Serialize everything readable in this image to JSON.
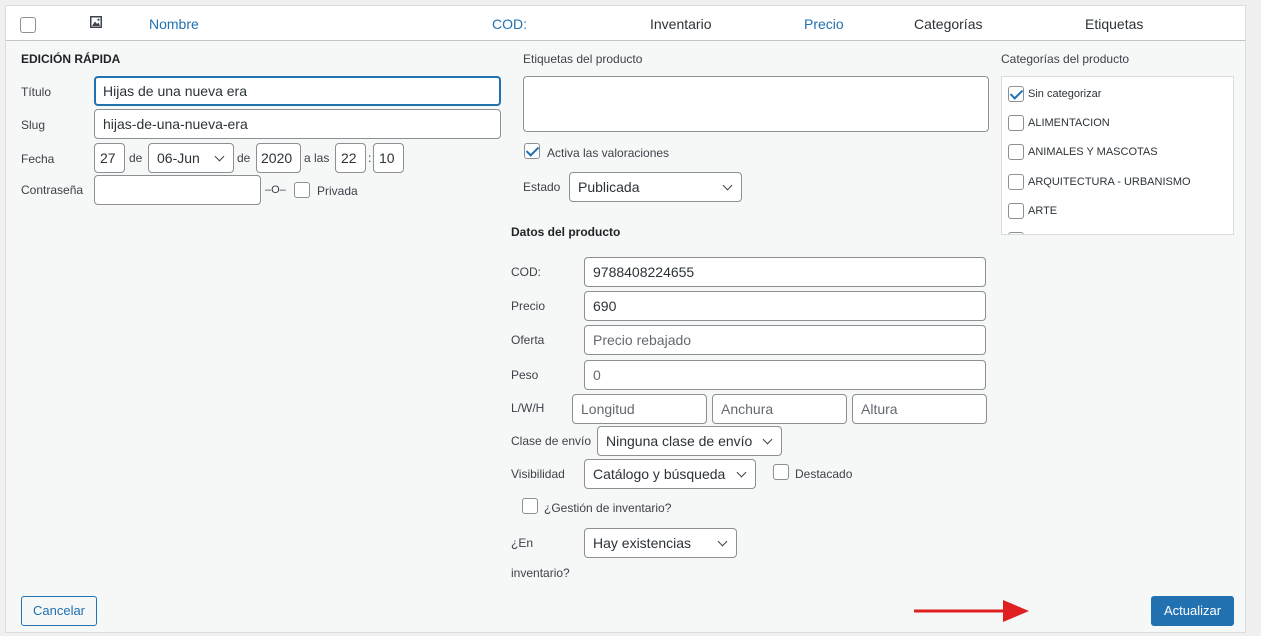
{
  "table_header": {
    "columns": [
      "Nombre",
      "COD:",
      "Inventario",
      "Precio",
      "Categorías",
      "Etiquetas"
    ]
  },
  "quick_edit": {
    "title": "EDICIÓN RÁPIDA",
    "titulo_label": "Título",
    "titulo_value": "Hijas de una nueva era",
    "slug_label": "Slug",
    "slug_value": "hijas-de-una-nueva-era",
    "fecha_label": "Fecha",
    "day": "27",
    "de1": "de",
    "month": "06-Jun",
    "de2": "de",
    "year": "2020",
    "a_las": "a las",
    "hour": "22",
    "colon": ":",
    "minute": "10",
    "password_label": "Contraseña",
    "password_value": "",
    "or_label": "–O–",
    "private_label": "Privada",
    "private_checked": false
  },
  "tags": {
    "label": "Etiquetas del producto",
    "value": "",
    "reviews_label": "Activa las valoraciones",
    "reviews_checked": true,
    "estado_label": "Estado",
    "estado_value": "Publicada"
  },
  "product_data": {
    "heading": "Datos del producto",
    "cod_label": "COD:",
    "cod_value": "9788408224655",
    "precio_label": "Precio",
    "precio_value": "690",
    "oferta_label": "Oferta",
    "oferta_placeholder": "Precio rebajado",
    "peso_label": "Peso",
    "peso_placeholder": "0",
    "lwh_label": "L/W/H",
    "longitud_placeholder": "Longitud",
    "anchura_placeholder": "Anchura",
    "altura_placeholder": "Altura",
    "envio_label": "Clase de envío",
    "envio_value": "Ninguna clase de envío",
    "visibilidad_label": "Visibilidad",
    "visibilidad_value": "Catálogo y búsqueda",
    "destacado_label": "Destacado",
    "destacado_checked": false,
    "gestion_label": "¿Gestión de inventario?",
    "gestion_checked": false,
    "en_inventario_label_1": "¿En",
    "en_inventario_label_2": "inventario?",
    "stock_value": "Hay existencias"
  },
  "categories": {
    "label": "Categorías del producto",
    "items": [
      {
        "label": "Sin categorizar",
        "checked": true
      },
      {
        "label": "ALIMENTACION",
        "checked": false
      },
      {
        "label": "ANIMALES Y MASCOTAS",
        "checked": false
      },
      {
        "label": "ARQUITECTURA - URBANISMO",
        "checked": false
      },
      {
        "label": "ARTE",
        "checked": false
      }
    ]
  },
  "buttons": {
    "cancel": "Cancelar",
    "update": "Actualizar"
  },
  "colors": {
    "accent": "#2271b1",
    "arrow": "#e02020"
  }
}
